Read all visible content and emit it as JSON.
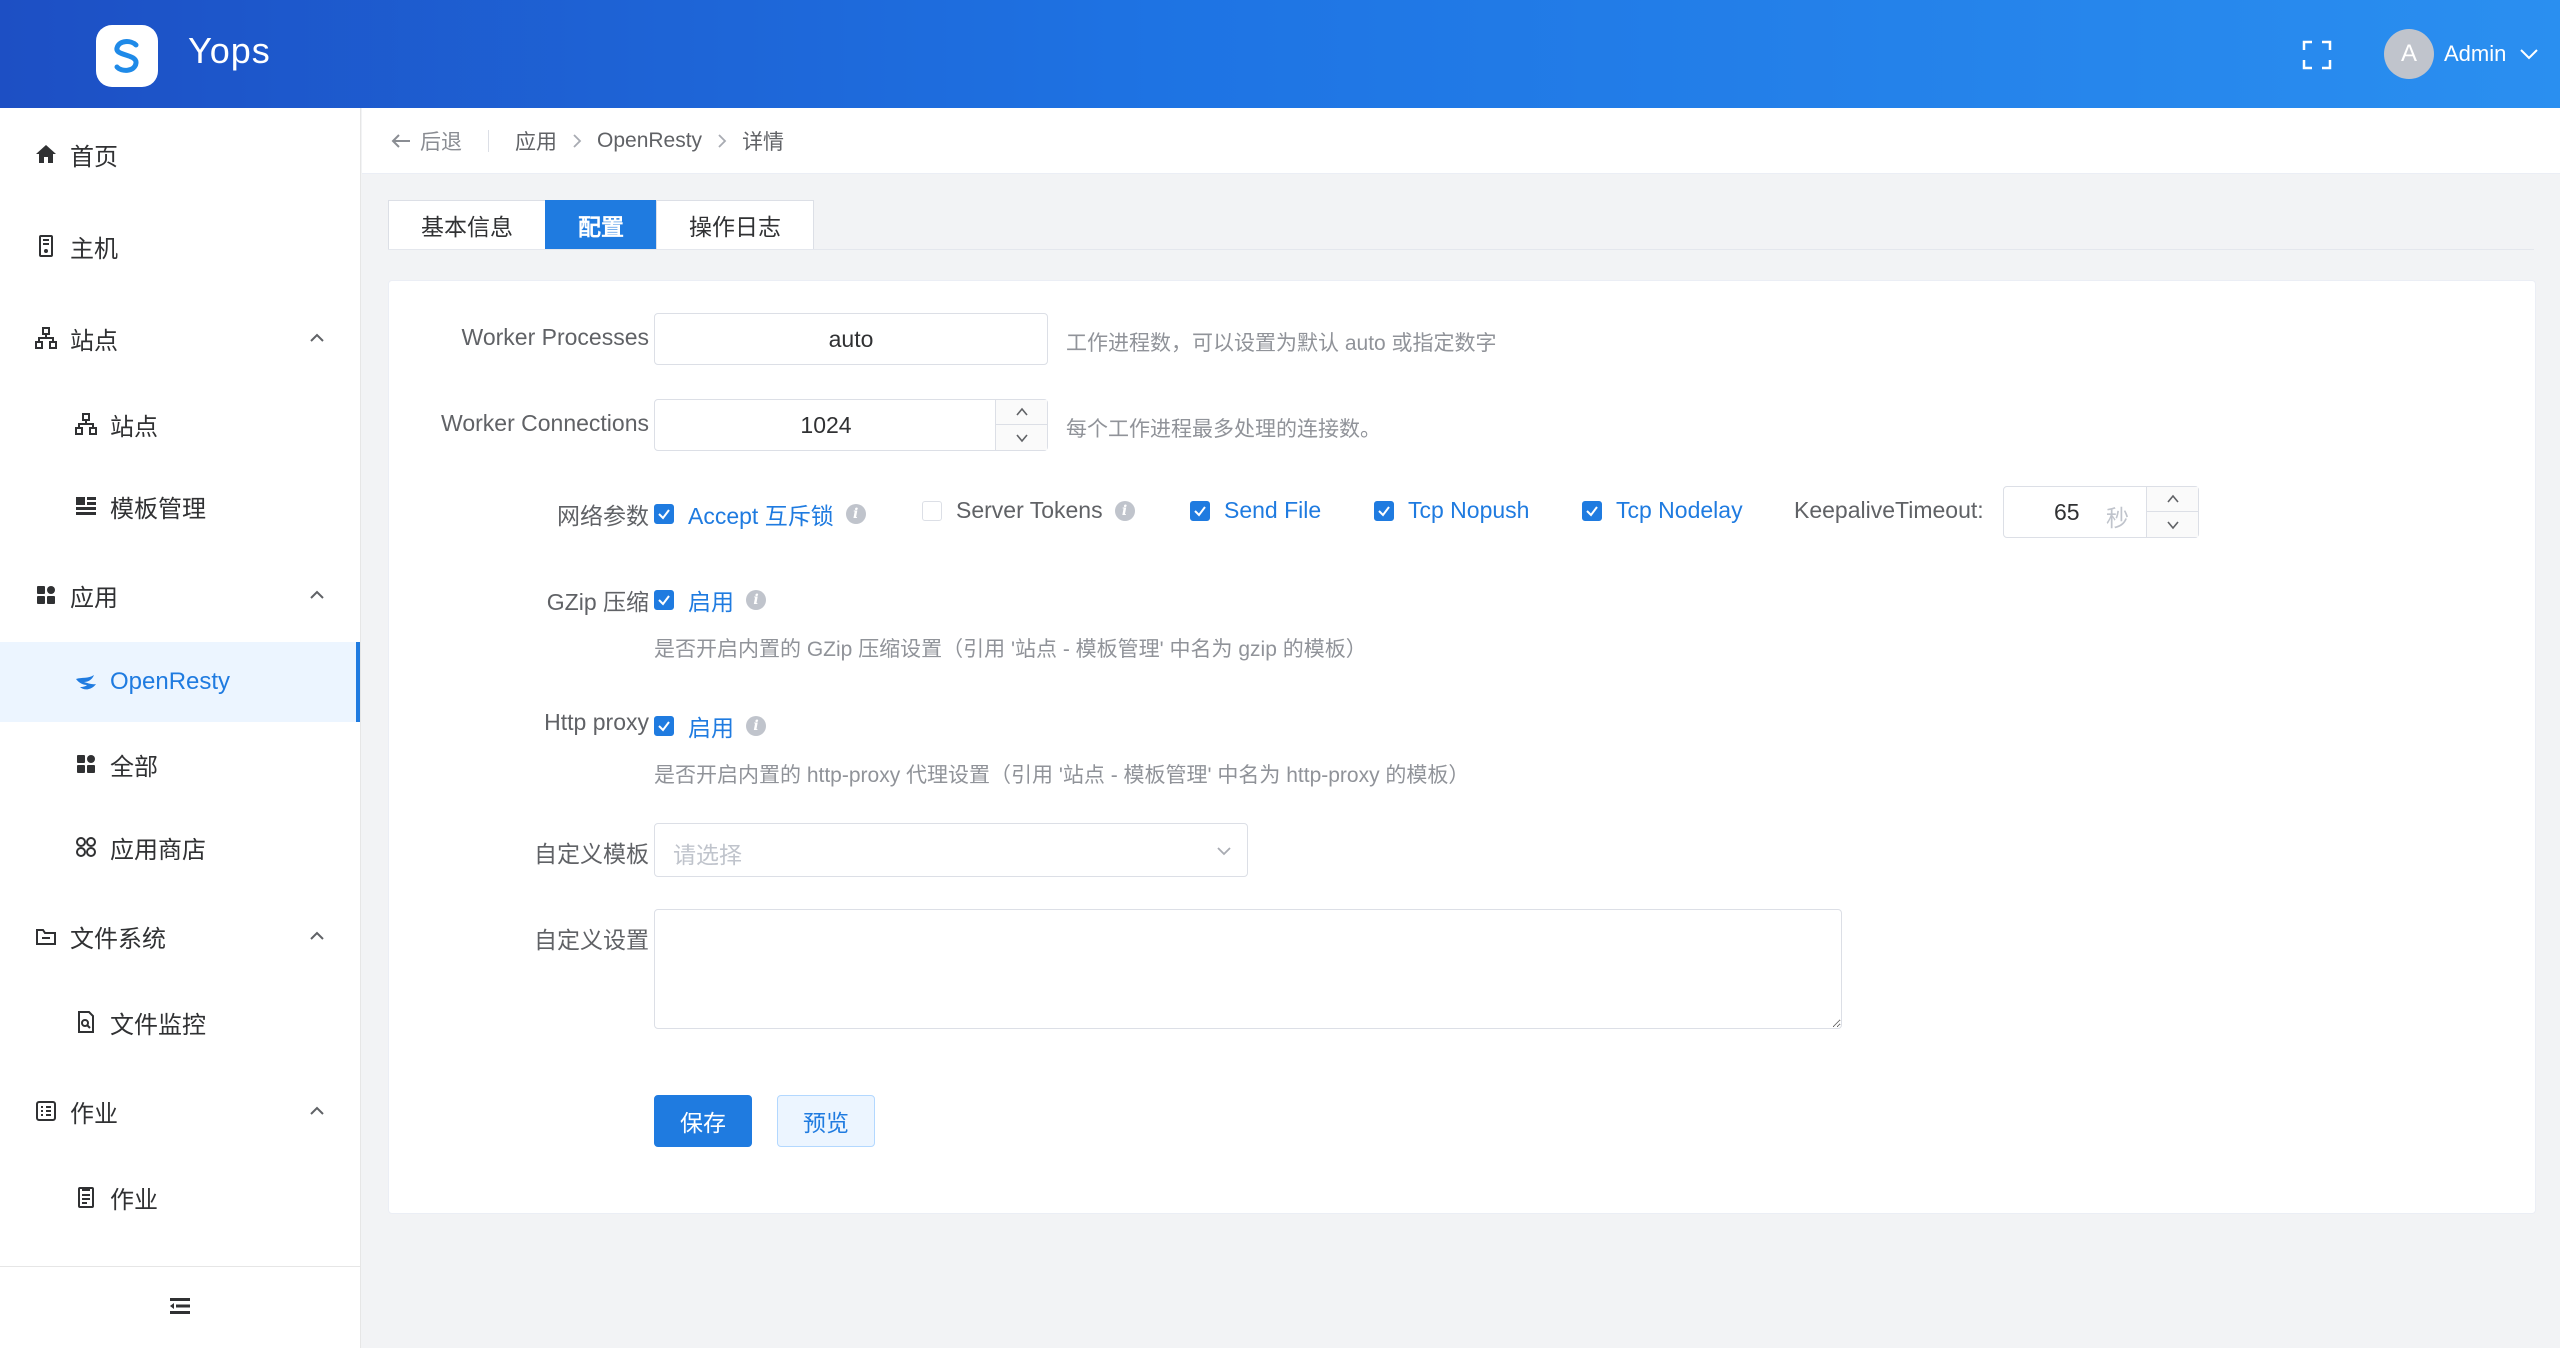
{
  "header": {
    "app_title": "Yops",
    "user_initial": "A",
    "user_name": "Admin"
  },
  "sidebar": {
    "items": [
      {
        "label": "首页",
        "icon": "home-icon"
      },
      {
        "label": "主机",
        "icon": "server-icon"
      },
      {
        "label": "站点",
        "icon": "sitemap-icon",
        "expanded": true
      },
      {
        "label": "站点",
        "icon": "sitemap-icon"
      },
      {
        "label": "模板管理",
        "icon": "template-icon"
      },
      {
        "label": "应用",
        "icon": "apps-icon",
        "expanded": true
      },
      {
        "label": "OpenResty",
        "icon": "openresty-icon",
        "active": true
      },
      {
        "label": "全部",
        "icon": "apps-icon"
      },
      {
        "label": "应用商店",
        "icon": "store-icon"
      },
      {
        "label": "文件系统",
        "icon": "folder-icon",
        "expanded": true
      },
      {
        "label": "文件监控",
        "icon": "file-monitor-icon"
      },
      {
        "label": "作业",
        "icon": "job-icon",
        "expanded": true
      },
      {
        "label": "作业",
        "icon": "task-icon"
      }
    ]
  },
  "breadcrumb": {
    "back": "后退",
    "items": [
      "应用",
      "OpenResty",
      "详情"
    ]
  },
  "tabs": [
    {
      "label": "基本信息",
      "active": false
    },
    {
      "label": "配置",
      "active": true
    },
    {
      "label": "操作日志",
      "active": false
    }
  ],
  "form": {
    "worker_processes": {
      "label": "Worker Processes",
      "value": "auto",
      "hint": "工作进程数，可以设置为默认 auto 或指定数字"
    },
    "worker_connections": {
      "label": "Worker Connections",
      "value": "1024",
      "hint": "每个工作进程最多处理的连接数。"
    },
    "network": {
      "label": "网络参数",
      "options": [
        {
          "label": "Accept 互斥锁",
          "checked": true,
          "info": true
        },
        {
          "label": "Server Tokens",
          "checked": false,
          "info": true
        },
        {
          "label": "Send File",
          "checked": true,
          "info": false
        },
        {
          "label": "Tcp Nopush",
          "checked": true,
          "info": false
        },
        {
          "label": "Tcp Nodelay",
          "checked": true,
          "info": false
        }
      ],
      "keepalive_label": "KeepaliveTimeout:",
      "keepalive_value": "65",
      "keepalive_unit": "秒"
    },
    "gzip": {
      "label": "GZip 压缩",
      "option": "启用",
      "checked": true,
      "hint": "是否开启内置的 GZip 压缩设置（引用 '站点 - 模板管理' 中名为 gzip 的模板）"
    },
    "http_proxy": {
      "label": "Http proxy",
      "option": "启用",
      "checked": true,
      "hint": "是否开启内置的 http-proxy 代理设置（引用 '站点 - 模板管理' 中名为 http-proxy 的模板）"
    },
    "custom_template": {
      "label": "自定义模板",
      "placeholder": "请选择"
    },
    "custom_settings": {
      "label": "自定义设置",
      "value": ""
    },
    "save_label": "保存",
    "preview_label": "预览"
  },
  "colors": {
    "primary": "#1f7be0",
    "header_start": "#1d4fc4",
    "header_end": "#2a8ff0"
  }
}
